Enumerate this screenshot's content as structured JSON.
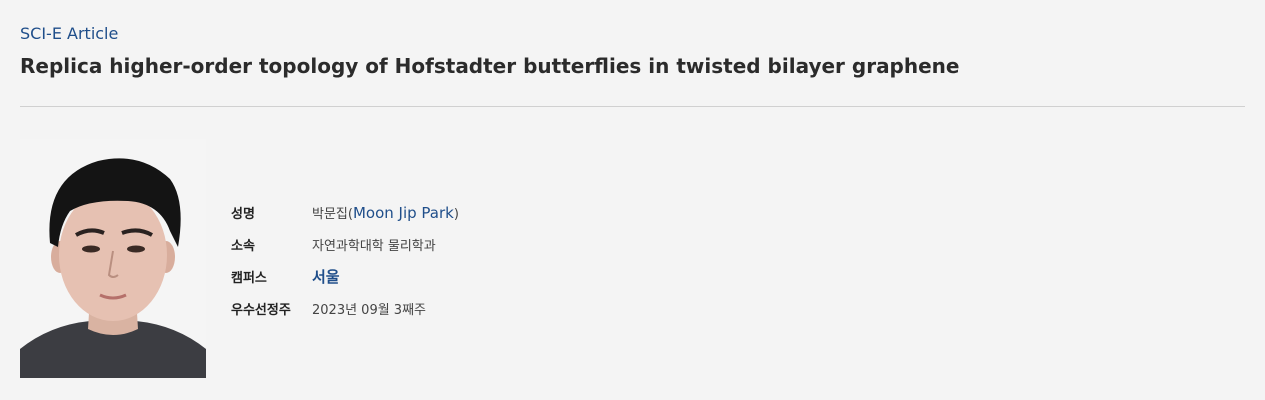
{
  "article": {
    "category": "SCI-E Article",
    "title": "Replica higher-order topology of Hofstadter butterflies in twisted bilayer graphene"
  },
  "profile": {
    "photo_icon": "person-photo",
    "name_label": "성명",
    "name_ko": "박문집(",
    "name_en": "Moon Jip Park",
    "name_close": ")",
    "affiliation_label": "소속",
    "affiliation_value": "자연과학대학 물리학과",
    "campus_label": "캠퍼스",
    "campus_value": "서울",
    "selection_label": "우수선정주",
    "selection_value": "2023년 09월 3째주"
  },
  "colors": {
    "accent": "#1f4e8a",
    "background": "#f4f4f4",
    "title": "#2b2b2b"
  }
}
